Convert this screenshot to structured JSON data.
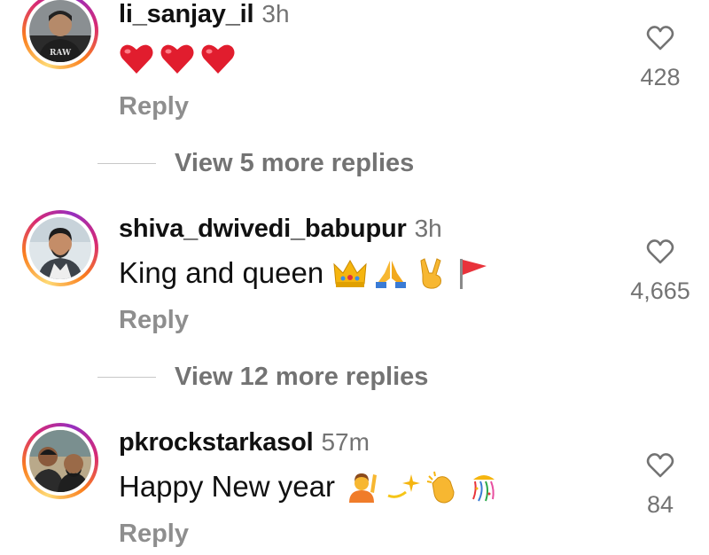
{
  "comments": [
    {
      "username": "li_sanjay_il",
      "time": "3h",
      "text": "",
      "emojis": [
        "red-heart",
        "red-heart",
        "red-heart"
      ],
      "reply_label": "Reply",
      "likes": "428",
      "avatar_text": "RAW"
    },
    {
      "username": "shiva_dwivedi_babupur",
      "time": "3h",
      "text": "King and queen",
      "emojis": [
        "crown",
        "folded-hands",
        "victory-hand",
        "triangular-flag"
      ],
      "reply_label": "Reply",
      "likes": "4,665"
    },
    {
      "username": "pkrockstarkasol",
      "time": "57m",
      "text": "Happy New year",
      "emojis": [
        "person-raising-hand",
        "dizzy",
        "clapping-hands",
        "confetti-ball"
      ],
      "reply_label": "Reply",
      "likes": "84"
    }
  ],
  "view_more": [
    {
      "label": "View 5 more replies"
    },
    {
      "label": "View 12 more replies"
    }
  ],
  "colors": {
    "username": "#111111",
    "muted": "#737373",
    "reply": "#8e8e8e",
    "ring_start": "#feda75",
    "ring_end": "#962fbf"
  }
}
